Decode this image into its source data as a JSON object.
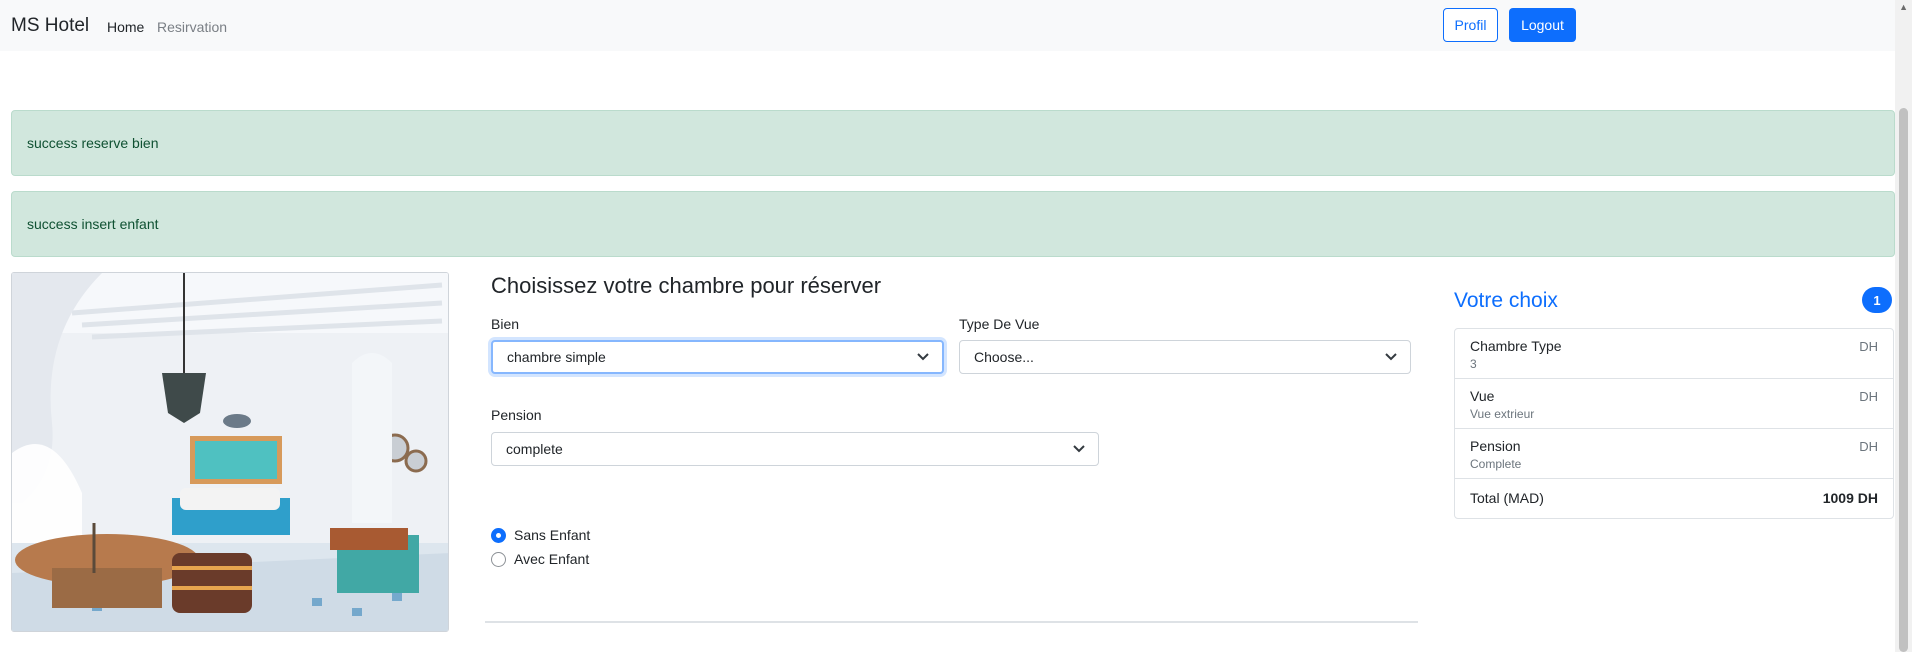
{
  "navbar": {
    "brand": "MS Hotel",
    "links": {
      "home": "Home",
      "reservation": "Resirvation"
    },
    "profil_label": "Profil",
    "logout_label": "Logout"
  },
  "alerts": [
    "success reserve bien",
    "success insert enfant"
  ],
  "form": {
    "title": "Choisissez votre chambre pour réserver",
    "bien": {
      "label": "Bien",
      "value": "chambre simple"
    },
    "vue": {
      "label": "Type De Vue",
      "value": "Choose..."
    },
    "pension": {
      "label": "Pension",
      "value": "complete"
    },
    "radios": [
      {
        "label": "Sans Enfant",
        "checked": true
      },
      {
        "label": "Avec Enfant",
        "checked": false
      }
    ]
  },
  "summary": {
    "title": "Votre choix",
    "badge": "1",
    "items": [
      {
        "name": "Chambre Type",
        "detail": "3",
        "price": "DH"
      },
      {
        "name": "Vue",
        "detail": "Vue extrieur",
        "price": "DH"
      },
      {
        "name": "Pension",
        "detail": "Complete",
        "price": "DH"
      }
    ],
    "total_label": "Total (MAD)",
    "total_value": "1009 DH"
  },
  "icons": {
    "select_arrow": "chevron-down-icon",
    "scroll_up": "arrow-up-icon"
  },
  "colors": {
    "primary": "#0d6efd",
    "alert_bg": "#d1e7dd",
    "alert_text": "#0f5132"
  }
}
